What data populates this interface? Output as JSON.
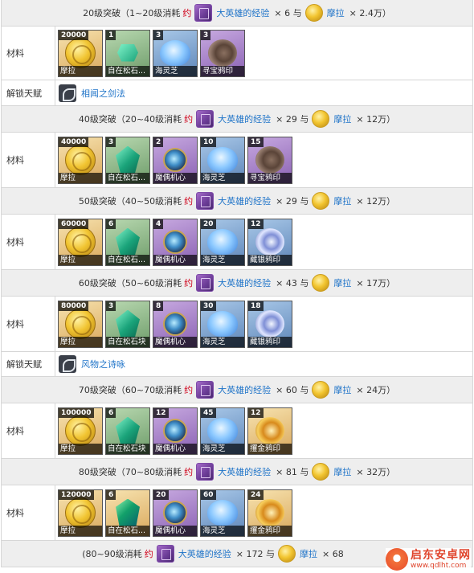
{
  "sections": [
    {
      "header": {
        "prefix": "20级突破（1~20级消耗",
        "yue": "约",
        "exp_name": "大英雄的经验",
        "exp_mult": "× 6 与",
        "mora_name": "摩拉",
        "mora_mult": "× 2.4万）"
      },
      "materials_label": "材料",
      "materials": [
        {
          "count": "20000",
          "name": "摩拉",
          "kind": "mora"
        },
        {
          "count": "1",
          "name": "自在松石...",
          "kind": "jade-s"
        },
        {
          "count": "3",
          "name": "海灵芝",
          "kind": "flower"
        },
        {
          "count": "3",
          "name": "寻宝鸦印",
          "kind": "snail"
        }
      ],
      "talent": {
        "label": "解锁天赋",
        "name": "相闻之剑法"
      }
    },
    {
      "header": {
        "prefix": "40级突破（20~40级消耗",
        "yue": "约",
        "exp_name": "大英雄的经验",
        "exp_mult": "× 29 与",
        "mora_name": "摩拉",
        "mora_mult": "× 12万）"
      },
      "materials_label": "材料",
      "materials": [
        {
          "count": "40000",
          "name": "摩拉",
          "kind": "mora"
        },
        {
          "count": "3",
          "name": "自在松石...",
          "kind": "jade"
        },
        {
          "count": "2",
          "name": "魔偶机心",
          "kind": "core"
        },
        {
          "count": "10",
          "name": "海灵芝",
          "kind": "flower"
        },
        {
          "count": "15",
          "name": "寻宝鸦印",
          "kind": "snail"
        }
      ]
    },
    {
      "header": {
        "prefix": "50级突破（40~50级消耗",
        "yue": "约",
        "exp_name": "大英雄的经验",
        "exp_mult": "× 29 与",
        "mora_name": "摩拉",
        "mora_mult": "× 12万）"
      },
      "materials_label": "材料",
      "materials": [
        {
          "count": "60000",
          "name": "摩拉",
          "kind": "mora"
        },
        {
          "count": "6",
          "name": "自在松石...",
          "kind": "jade"
        },
        {
          "count": "4",
          "name": "魔偶机心",
          "kind": "core"
        },
        {
          "count": "20",
          "name": "海灵芝",
          "kind": "flower"
        },
        {
          "count": "12",
          "name": "藏银鸦印",
          "kind": "snail-b"
        }
      ]
    },
    {
      "header": {
        "prefix": "60级突破（50~60级消耗",
        "yue": "约",
        "exp_name": "大英雄的经验",
        "exp_mult": "× 43 与",
        "mora_name": "摩拉",
        "mora_mult": "× 17万）"
      },
      "materials_label": "材料",
      "materials": [
        {
          "count": "80000",
          "name": "摩拉",
          "kind": "mora"
        },
        {
          "count": "3",
          "name": "自在松石块",
          "kind": "jade"
        },
        {
          "count": "8",
          "name": "魔偶机心",
          "kind": "core"
        },
        {
          "count": "30",
          "name": "海灵芝",
          "kind": "flower"
        },
        {
          "count": "18",
          "name": "藏银鸦印",
          "kind": "snail-b"
        }
      ],
      "talent": {
        "label": "解锁天赋",
        "name": "风物之诗咏"
      }
    },
    {
      "header": {
        "prefix": "70级突破（60~70级消耗",
        "yue": "约",
        "exp_name": "大英雄的经验",
        "exp_mult": "× 60 与",
        "mora_name": "摩拉",
        "mora_mult": "× 24万）"
      },
      "materials_label": "材料",
      "materials": [
        {
          "count": "100000",
          "name": "摩拉",
          "kind": "mora"
        },
        {
          "count": "6",
          "name": "自在松石块",
          "kind": "jade"
        },
        {
          "count": "12",
          "name": "魔偶机心",
          "kind": "core"
        },
        {
          "count": "45",
          "name": "海灵芝",
          "kind": "flower"
        },
        {
          "count": "12",
          "name": "攫金鸦印",
          "kind": "snail-g"
        }
      ]
    },
    {
      "header": {
        "prefix": "80级突破（70~80级消耗",
        "yue": "约",
        "exp_name": "大英雄的经验",
        "exp_mult": "× 81 与",
        "mora_name": "摩拉",
        "mora_mult": "× 32万）"
      },
      "materials_label": "材料",
      "materials": [
        {
          "count": "120000",
          "name": "摩拉",
          "kind": "mora"
        },
        {
          "count": "6",
          "name": "自在松石...",
          "kind": "jade-o"
        },
        {
          "count": "20",
          "name": "魔偶机心",
          "kind": "core"
        },
        {
          "count": "60",
          "name": "海灵芝",
          "kind": "flower"
        },
        {
          "count": "24",
          "name": "攫金鸦印",
          "kind": "snail-g"
        }
      ]
    }
  ],
  "last_header": {
    "prefix": "(80~90级消耗",
    "yue": "约",
    "exp_name": "大英雄的经验",
    "exp_mult": "× 172 与",
    "mora_name": "摩拉",
    "mora_mult": "× 68"
  },
  "watermark": {
    "title": "启东安卓网",
    "url": "www.qdlht.com"
  },
  "colors": {
    "link": "#1e73c8",
    "accent_red": "#d0021b",
    "header_bg": "#eeeeee"
  }
}
